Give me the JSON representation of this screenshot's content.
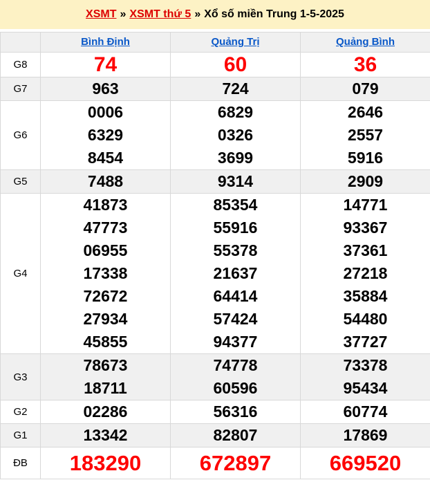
{
  "colors": {
    "banner_bg": "#fdf2c5",
    "stripe_bg": "#f0f0f0",
    "border": "#d8d8d8",
    "breadcrumb_link_red": "#dd0000",
    "column_link_blue": "#0a58c8",
    "prize_highlight_red": "#fe0000",
    "text": "#000000"
  },
  "breadcrumb": {
    "link_xsmt": "XSMT",
    "separator": "»",
    "link_day": "XSMT thứ 5",
    "title": "Xổ số miền Trung 1-5-2025"
  },
  "table": {
    "columns": [
      "Bình Định",
      "Quảng Trị",
      "Quảng Bình"
    ],
    "rows": [
      {
        "label": "G8",
        "cells": [
          [
            "74"
          ],
          [
            "60"
          ],
          [
            "36"
          ]
        ]
      },
      {
        "label": "G7",
        "cells": [
          [
            "963"
          ],
          [
            "724"
          ],
          [
            "079"
          ]
        ]
      },
      {
        "label": "G6",
        "cells": [
          [
            "0006",
            "6329",
            "8454"
          ],
          [
            "6829",
            "0326",
            "3699"
          ],
          [
            "2646",
            "2557",
            "5916"
          ]
        ]
      },
      {
        "label": "G5",
        "cells": [
          [
            "7488"
          ],
          [
            "9314"
          ],
          [
            "2909"
          ]
        ]
      },
      {
        "label": "G4",
        "cells": [
          [
            "41873",
            "47773",
            "06955",
            "17338",
            "72672",
            "27934",
            "45855"
          ],
          [
            "85354",
            "55916",
            "55378",
            "21637",
            "64414",
            "57424",
            "94377"
          ],
          [
            "14771",
            "93367",
            "37361",
            "27218",
            "35884",
            "54480",
            "37727"
          ]
        ]
      },
      {
        "label": "G3",
        "cells": [
          [
            "78673",
            "18711"
          ],
          [
            "74778",
            "60596"
          ],
          [
            "73378",
            "95434"
          ]
        ]
      },
      {
        "label": "G2",
        "cells": [
          [
            "02286"
          ],
          [
            "56316"
          ],
          [
            "60774"
          ]
        ]
      },
      {
        "label": "G1",
        "cells": [
          [
            "13342"
          ],
          [
            "82807"
          ],
          [
            "17869"
          ]
        ]
      },
      {
        "label": "ĐB",
        "cells": [
          [
            "183290"
          ],
          [
            "672897"
          ],
          [
            "669520"
          ]
        ]
      }
    ]
  }
}
